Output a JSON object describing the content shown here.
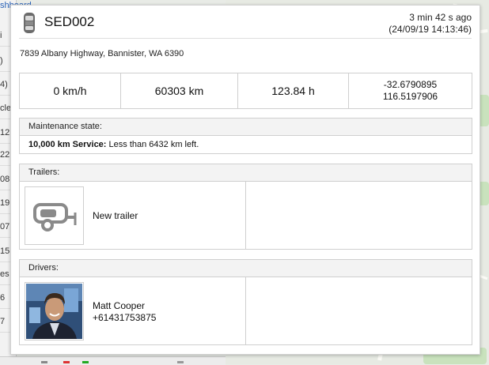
{
  "background": {
    "top_link": "shboard",
    "list_rows": [
      "i",
      ")",
      "4)",
      "cle",
      "12",
      "22",
      "08",
      "19",
      "07",
      "15",
      "es",
      "6",
      "7"
    ]
  },
  "popup": {
    "vehicle_icon": "car-icon",
    "vehicle_name": "SED002",
    "time_ago": "3 min 42 s ago",
    "timestamp": "(24/09/19 14:13:46)",
    "address": "7839 Albany Highway, Bannister, WA 6390",
    "stats": {
      "speed": "0 km/h",
      "odometer": "60303 km",
      "engine_hours": "123.84 h",
      "latitude": "-32.6790895",
      "longitude": "116.5197906"
    },
    "maintenance": {
      "title": "Maintenance state:",
      "service_name": "10,000 km Service:",
      "service_status": "Less than 6432 km left."
    },
    "trailers": {
      "title": "Trailers:",
      "icon": "trailer-icon",
      "name": "New trailer"
    },
    "drivers": {
      "title": "Drivers:",
      "name": "Matt Cooper",
      "phone": "+61431753875"
    }
  },
  "colors": {
    "link": "#2a62b8",
    "section_header_bg": "#f3f3f3",
    "border": "#cfcfcf",
    "map_bg": "#e7eae3",
    "map_green": "#c9e2bd"
  }
}
